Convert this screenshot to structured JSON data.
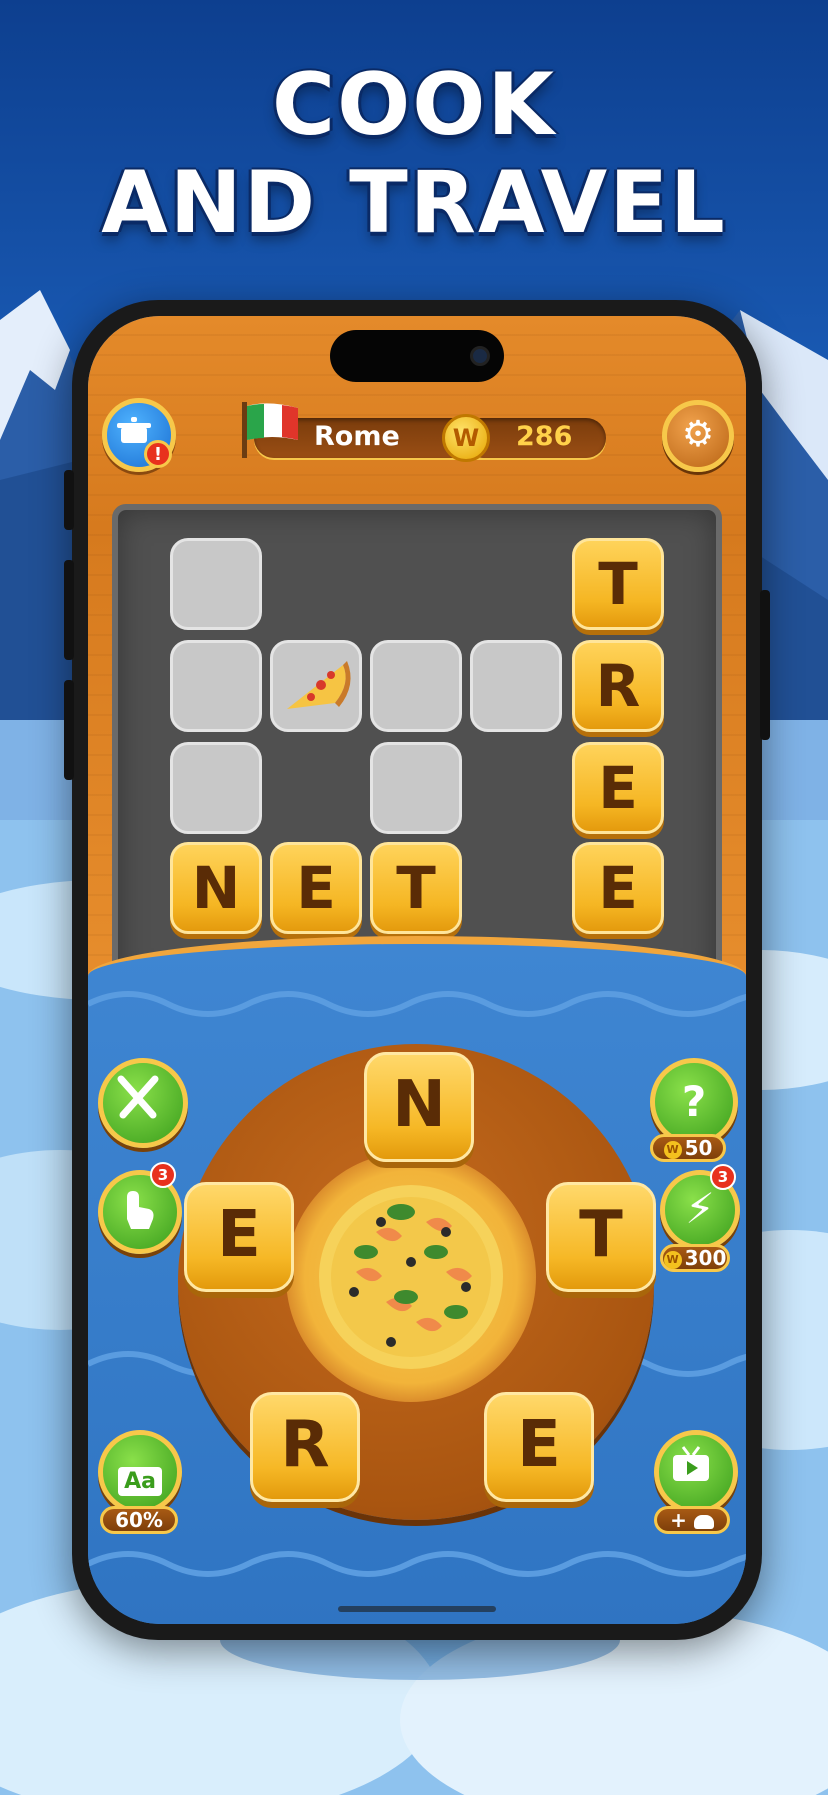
{
  "headline": {
    "line1": "COOK",
    "line2": "AND TRAVEL"
  },
  "header": {
    "city": "Rome",
    "coins": "286",
    "coin_symbol": "W",
    "alert": "!",
    "flag_icon": "italy-flag-icon",
    "pot_icon": "cooking-pot-icon",
    "settings_icon": "gear-icon"
  },
  "board": {
    "filled_letters": [
      "T",
      "R",
      "E",
      "E",
      "N",
      "E",
      "T"
    ],
    "hint_icon": "pizza-slice-icon"
  },
  "wheel": {
    "letters": [
      "N",
      "E",
      "T",
      "R",
      "E"
    ],
    "center_icon": "pizza-icon"
  },
  "buttons": {
    "cutlery": {
      "icon": "fork-knife-icon"
    },
    "finger_hint": {
      "icon": "finger-tap-icon",
      "count": "3"
    },
    "chef_hint": {
      "icon": "chef-question-icon",
      "price": "50"
    },
    "lightning": {
      "icon": "lightning-icon",
      "count": "3",
      "price": "300"
    },
    "dictionary": {
      "icon": "dictionary-icon",
      "label": "Aa",
      "progress": "60%"
    },
    "video": {
      "icon": "video-reward-icon",
      "reward": "+"
    }
  },
  "colors": {
    "wood": "#e48a2a",
    "tile": "#f6b826",
    "board": "#505050",
    "sea": "#3f86d2"
  }
}
